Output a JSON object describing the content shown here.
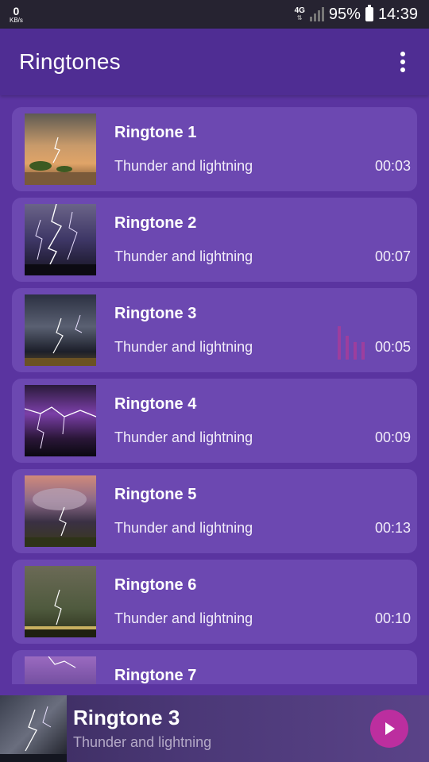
{
  "status_bar": {
    "net_speed": "0",
    "net_unit": "KB/s",
    "network": "4G",
    "battery": "95%",
    "time": "14:39"
  },
  "app_bar": {
    "title": "Ringtones",
    "menu_icon": "more-vert-icon"
  },
  "ringtones": [
    {
      "title": "Ringtone 1",
      "subtitle": "Thunder and lightning",
      "duration": "00:03"
    },
    {
      "title": "Ringtone 2",
      "subtitle": "Thunder and lightning",
      "duration": "00:07"
    },
    {
      "title": "Ringtone 3",
      "subtitle": "Thunder and lightning",
      "duration": "00:05",
      "playing": true
    },
    {
      "title": "Ringtone 4",
      "subtitle": "Thunder and lightning",
      "duration": "00:09"
    },
    {
      "title": "Ringtone 5",
      "subtitle": "Thunder and lightning",
      "duration": "00:13"
    },
    {
      "title": "Ringtone 6",
      "subtitle": "Thunder and lightning",
      "duration": "00:10"
    },
    {
      "title": "Ringtone 7",
      "subtitle": "",
      "duration": ""
    }
  ],
  "player": {
    "title": "Ringtone 3",
    "subtitle": "Thunder and lightning",
    "button_icon": "play-icon"
  },
  "colors": {
    "background": "#5a34a0",
    "app_bar": "#4f2d93",
    "card": "#6c48b1",
    "accent": "#bc2e9f"
  }
}
